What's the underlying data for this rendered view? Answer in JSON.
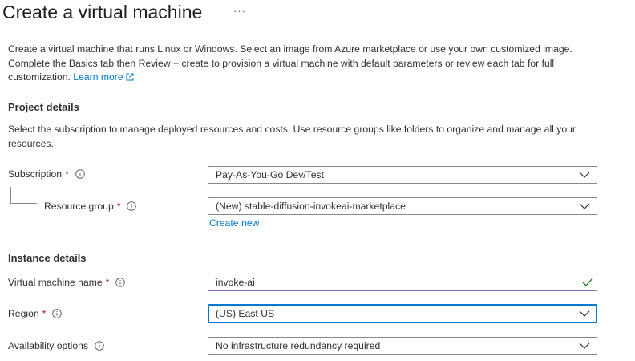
{
  "header": {
    "title": "Create a virtual machine",
    "more_actions": "···"
  },
  "intro": {
    "text": "Create a virtual machine that runs Linux or Windows. Select an image from Azure marketplace or use your own customized image. Complete the Basics tab then Review + create to provision a virtual machine with default parameters or review each tab for full customization.",
    "learn_more": "Learn more"
  },
  "project_details": {
    "title": "Project details",
    "description": "Select the subscription to manage deployed resources and costs. Use resource groups like folders to organize and manage all your resources.",
    "subscription": {
      "label": "Subscription",
      "required": "*",
      "value": "Pay-As-You-Go Dev/Test"
    },
    "resource_group": {
      "label": "Resource group",
      "required": "*",
      "value": "(New) stable-diffusion-invokeai-marketplace",
      "create_new": "Create new"
    }
  },
  "instance_details": {
    "title": "Instance details",
    "vm_name": {
      "label": "Virtual machine name",
      "required": "*",
      "value": "invoke-ai"
    },
    "region": {
      "label": "Region",
      "required": "*",
      "value": "(US) East US"
    },
    "availability": {
      "label": "Availability options",
      "value": "No infrastructure redundancy required"
    }
  },
  "colors": {
    "accent": "#0078d4",
    "required": "#a4262c",
    "valid_check": "#107c10",
    "valid_border": "#8764b8"
  }
}
